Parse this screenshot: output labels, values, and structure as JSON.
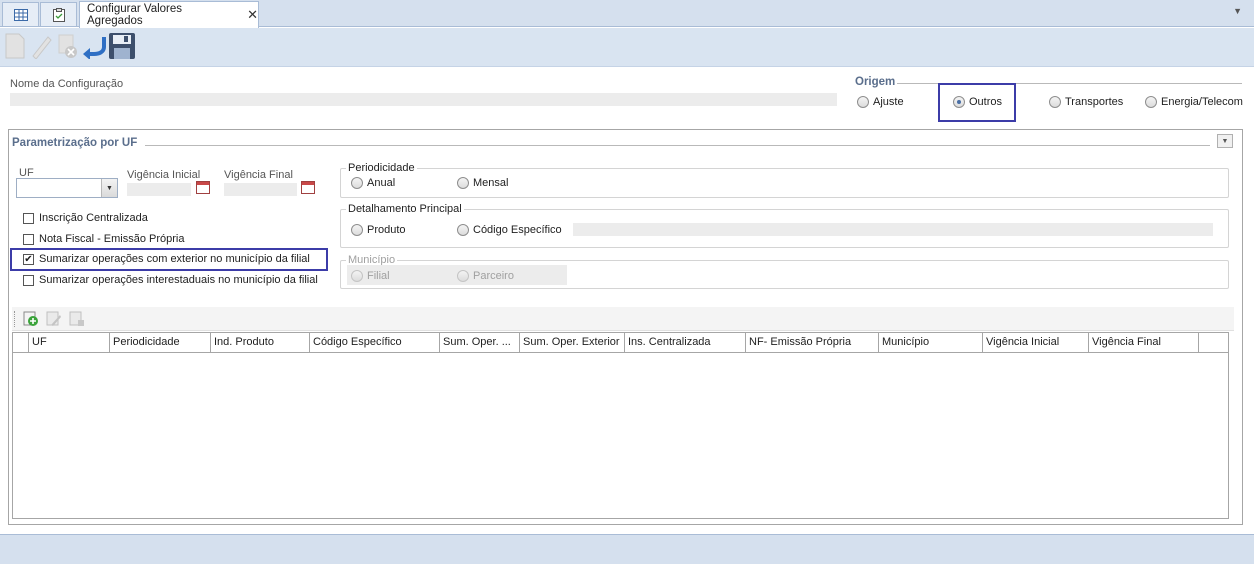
{
  "tabs": {
    "active_label": "Configurar Valores Agregados",
    "close_glyph": "✕",
    "menu_glyph": "▼",
    "icons": [
      "grid-icon",
      "clipboard-icon"
    ]
  },
  "toolbar": {
    "buttons": [
      "new-icon",
      "edit-icon",
      "delete-icon",
      "undo-icon",
      "save-icon"
    ]
  },
  "config": {
    "name_label": "Nome da Configuração",
    "name_value": ""
  },
  "origem": {
    "title": "Origem",
    "options": [
      "Ajuste",
      "Outros",
      "Transportes",
      "Energia/Telecom"
    ],
    "selected": "Outros"
  },
  "param": {
    "title": "Parametrização por UF",
    "uf_label": "UF",
    "uf_value": "",
    "vig_ini_label": "Vigência Inicial",
    "vig_fim_label": "Vigência Final",
    "checks": [
      {
        "label": "Inscrição Centralizada",
        "checked": false
      },
      {
        "label": "Nota Fiscal - Emissão Própria",
        "checked": false
      },
      {
        "label": "Sumarizar operações com exterior no município da filial",
        "checked": true
      },
      {
        "label": "Sumarizar operações interestaduais no município da filial",
        "checked": false
      }
    ],
    "check_mark": "✔",
    "periodicidade": {
      "title": "Periodicidade",
      "options": [
        "Anual",
        "Mensal"
      ]
    },
    "detalhamento": {
      "title": "Detalhamento Principal",
      "options": [
        "Produto",
        "Código Específico"
      ]
    },
    "municipio": {
      "title": "Município",
      "options": [
        "Filial",
        "Parceiro"
      ]
    }
  },
  "grid": {
    "columns": [
      "UF",
      "Periodicidade",
      "Ind. Produto",
      "Código Específico",
      "Sum. Oper. ...",
      "Sum. Oper. Exterior",
      "Ins. Centralizada",
      "NF- Emissão Própria",
      "Município",
      "Vigência Inicial",
      "Vigência Final"
    ],
    "toolbar": [
      "add-row-icon",
      "edit-row-icon",
      "delete-row-icon"
    ]
  },
  "colors": {
    "accent": "#3c3ca8",
    "tabbar": "#d5e0ee",
    "group_title": "#5a6e8c"
  }
}
